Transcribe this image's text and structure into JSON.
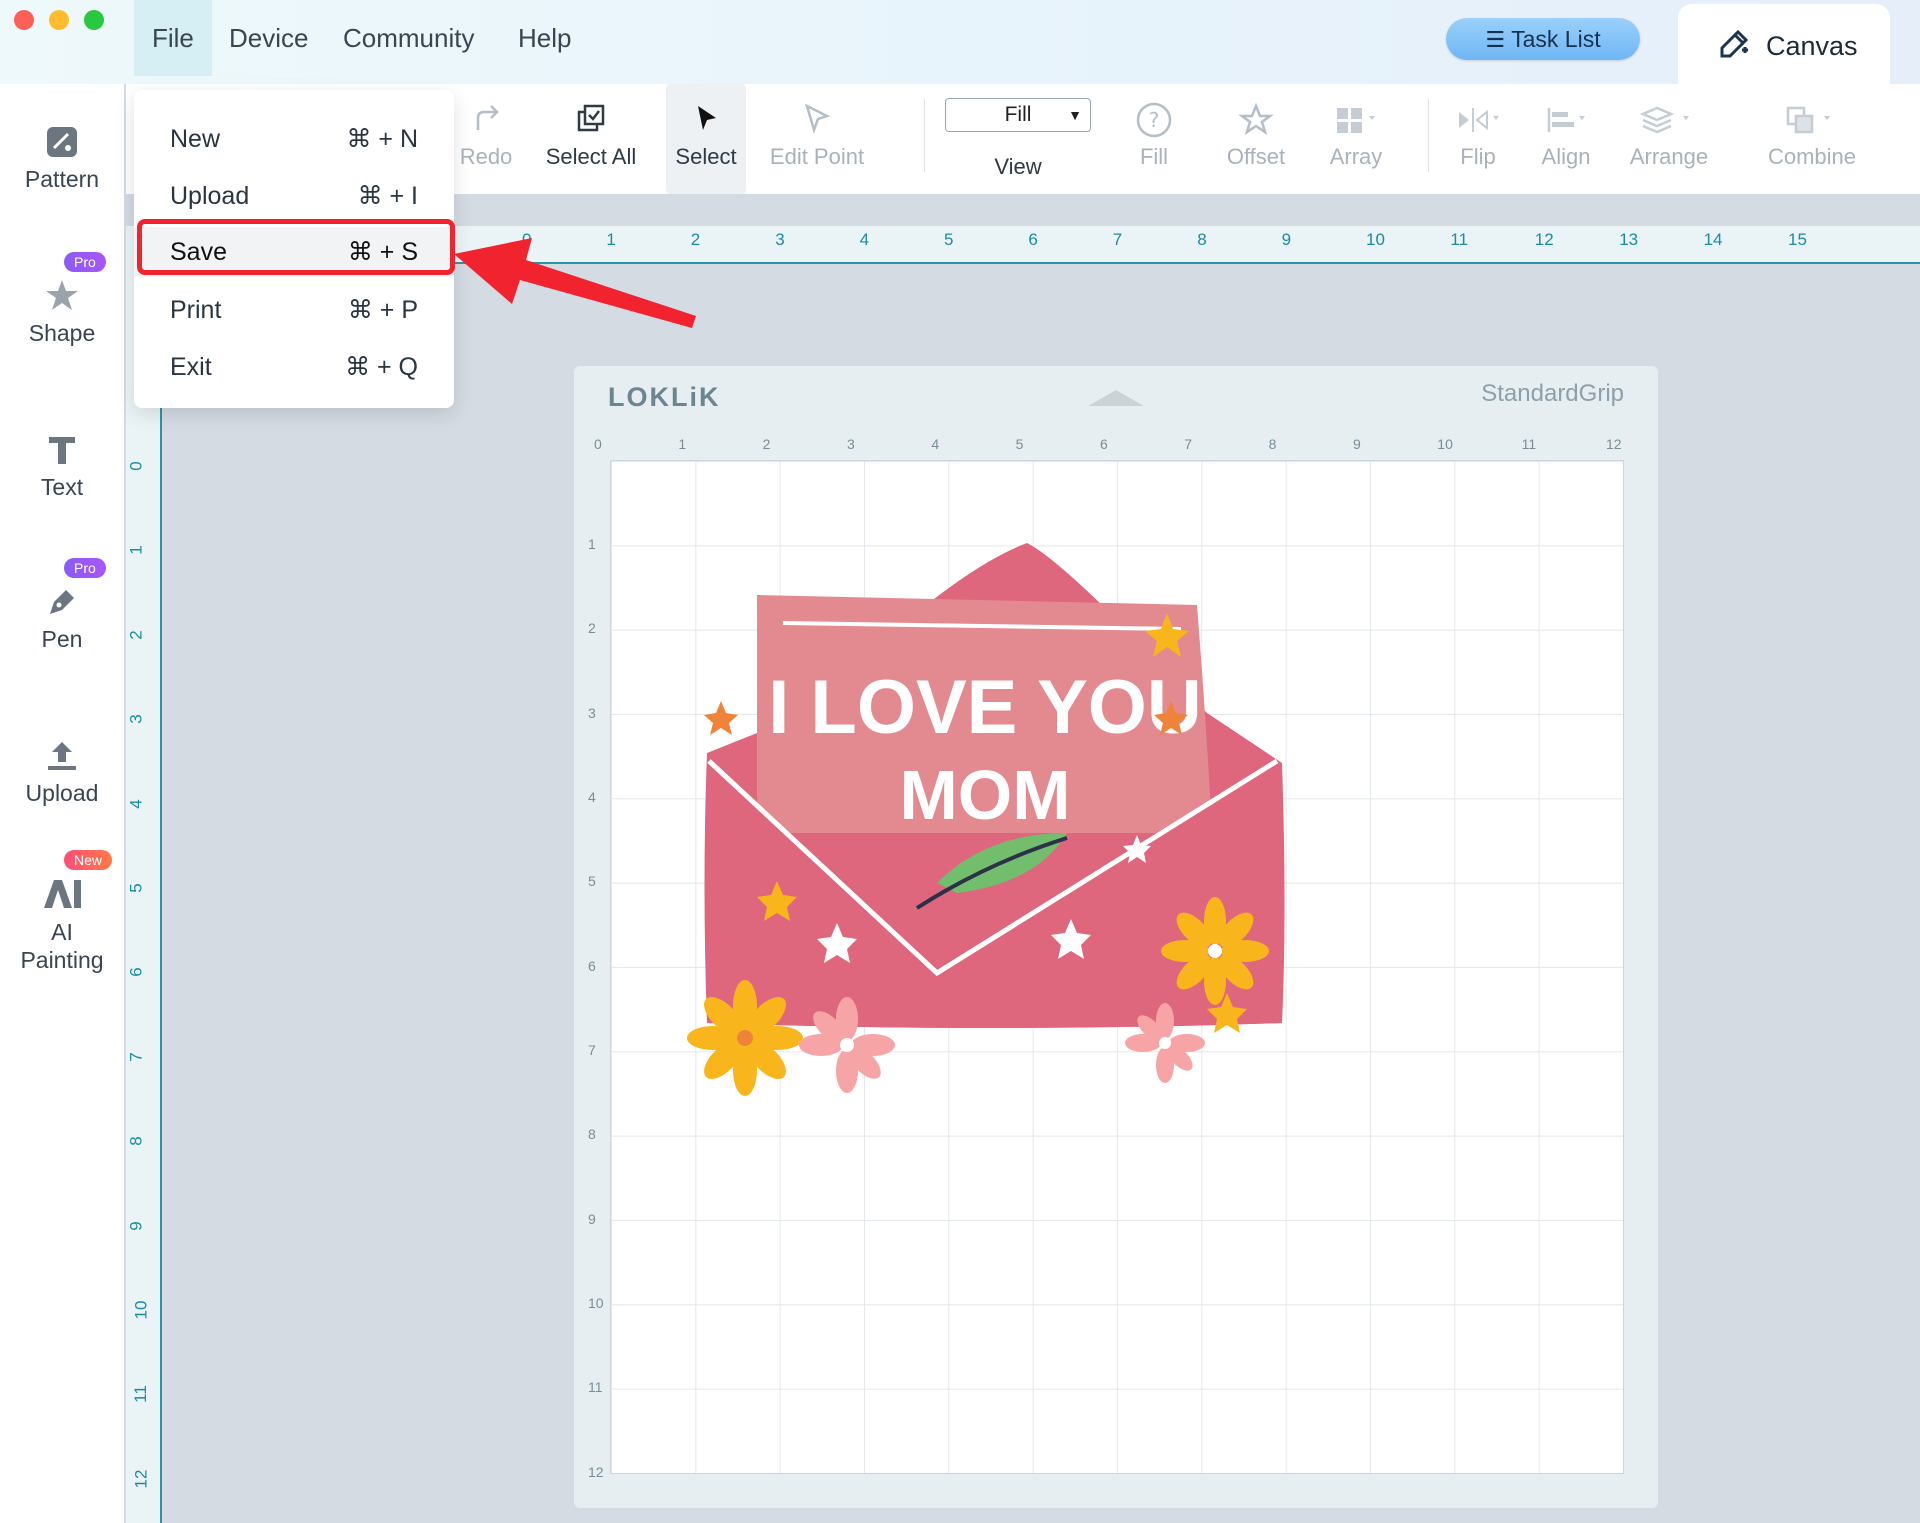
{
  "menu": {
    "items": [
      "File",
      "Device",
      "Community",
      "Help"
    ],
    "active": "File"
  },
  "header": {
    "task_list_label": "Task List",
    "canvas_tab_label": "Canvas"
  },
  "toolbar": {
    "redo": "Redo",
    "select_all": "Select All",
    "select": "Select",
    "edit_point": "Edit Point",
    "fill_value": "Fill",
    "view": "View",
    "fill": "Fill",
    "offset": "Offset",
    "array": "Array",
    "flip": "Flip",
    "align": "Align",
    "arrange": "Arrange",
    "combine": "Combine"
  },
  "sidebar": {
    "items": [
      {
        "label": "Pattern",
        "badge": ""
      },
      {
        "label": "Shape",
        "badge": "Pro"
      },
      {
        "label": "Text",
        "badge": ""
      },
      {
        "label": "Pen",
        "badge": "Pro"
      },
      {
        "label": "Upload",
        "badge": ""
      },
      {
        "label": "AI Painting",
        "badge": "New",
        "label_line1": "AI",
        "label_line2": "Painting"
      }
    ]
  },
  "file_menu": {
    "items": [
      {
        "label": "New",
        "shortcut": "⌘ + N"
      },
      {
        "label": "Upload",
        "shortcut": "⌘ + I"
      },
      {
        "label": "Save",
        "shortcut": "⌘ + S"
      },
      {
        "label": "Print",
        "shortcut": "⌘ + P"
      },
      {
        "label": "Exit",
        "shortcut": "⌘ + Q"
      }
    ],
    "highlighted": "Save"
  },
  "rulers": {
    "horizontal": [
      "1",
      "0",
      "1",
      "2",
      "3",
      "4",
      "5",
      "6",
      "7",
      "8",
      "9",
      "10",
      "11",
      "12",
      "13",
      "14",
      "15"
    ],
    "vertical": [
      "0",
      "1",
      "2",
      "3",
      "4",
      "5",
      "6",
      "7",
      "8",
      "9",
      "10",
      "11",
      "12"
    ]
  },
  "mat": {
    "brand": "LOKLiK",
    "grip": "StandardGrip",
    "top_ticks": [
      "0",
      "1",
      "2",
      "3",
      "4",
      "5",
      "6",
      "7",
      "8",
      "9",
      "10",
      "11",
      "12"
    ],
    "side_ticks": [
      "1",
      "2",
      "3",
      "4",
      "5",
      "6",
      "7",
      "8",
      "9",
      "10",
      "11",
      "12"
    ]
  },
  "design": {
    "line1": "I LOVE YOU",
    "line2": "MOM"
  },
  "colors": {
    "accent": "#2b95a8",
    "highlight": "#f0232f",
    "envelope": "#de667d",
    "letter": "#e38a90"
  }
}
